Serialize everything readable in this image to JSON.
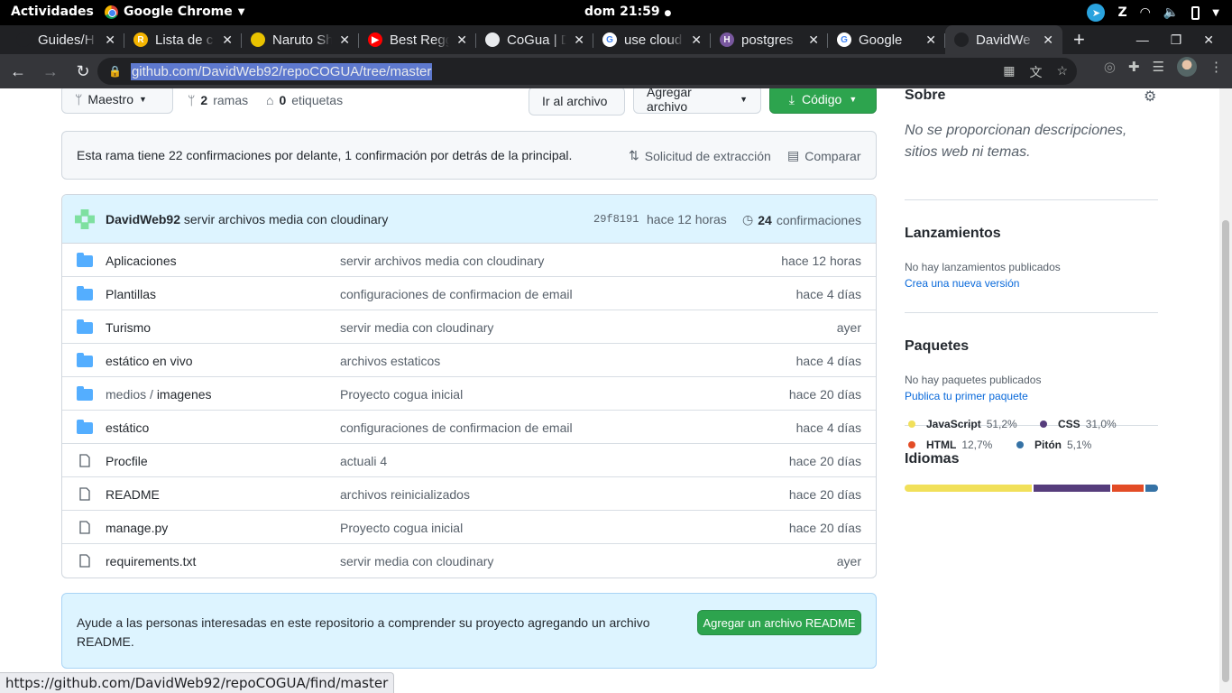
{
  "gnome": {
    "activities": "Actividades",
    "app": "Google Chrome",
    "clock": "dom 21:59"
  },
  "tabs": [
    {
      "title": "Guides/H",
      "fav_color": "#202124",
      "fav_text": ""
    },
    {
      "title": "Lista de c",
      "fav_color": "#f4b400",
      "fav_text": "R"
    },
    {
      "title": "Naruto Sh",
      "fav_color": "#e8c200",
      "fav_text": ""
    },
    {
      "title": "Best Regg",
      "fav_color": "#ff0000",
      "fav_text": "▶"
    },
    {
      "title": "CoGua | D",
      "fav_color": "#e8eaed",
      "fav_text": ""
    },
    {
      "title": "use cloud",
      "fav_color": "#ffffff",
      "fav_text": "G"
    },
    {
      "title": "postgres",
      "fav_color": "#79589f",
      "fav_text": "H"
    },
    {
      "title": "Google",
      "fav_color": "#ffffff",
      "fav_text": "G"
    },
    {
      "title": "DavidWe",
      "fav_color": "#202124",
      "fav_text": ""
    }
  ],
  "omnibox": {
    "url": "github.com/DavidWeb92/repoCOGUA/tree/master"
  },
  "repo": {
    "branch_label": "Maestro",
    "branches_count": "2",
    "branches_label": "ramas",
    "tags_count": "0",
    "tags_label": "etiquetas",
    "goto_file": "Ir al archivo",
    "add_file": "Agregar archivo",
    "code": "Código",
    "ahead_msg": "Esta rama tiene 22 confirmaciones por delante, 1 confirmación por detrás de la principal.",
    "pull_request": "Solicitud de extracción",
    "compare": "Comparar"
  },
  "commit": {
    "author": "DavidWeb92",
    "message": "servir archivos media con cloudinary",
    "sha": "29f8191",
    "time": "hace 12 horas",
    "count": "24",
    "count_label": "confirmaciones"
  },
  "files": [
    {
      "type": "folder",
      "prefix": "",
      "name": "Aplicaciones",
      "msg": "servir archivos media con cloudinary",
      "age": "hace 12 horas"
    },
    {
      "type": "folder",
      "prefix": "",
      "name": "Plantillas",
      "msg": "configuraciones de confirmacion de email",
      "age": "hace 4 días"
    },
    {
      "type": "folder",
      "prefix": "",
      "name": "Turismo",
      "msg": "servir media con cloudinary",
      "age": "ayer"
    },
    {
      "type": "folder",
      "prefix": "",
      "name": "estático en vivo",
      "msg": "archivos estaticos",
      "age": "hace 4 días"
    },
    {
      "type": "folder",
      "prefix": "medios / ",
      "name": "imagenes",
      "msg": "Proyecto cogua inicial",
      "age": "hace 20 días"
    },
    {
      "type": "folder",
      "prefix": "",
      "name": "estático",
      "msg": "configuraciones de confirmacion de email",
      "age": "hace 4 días"
    },
    {
      "type": "file",
      "prefix": "",
      "name": "Procfile",
      "msg": "actuali 4",
      "age": "hace 20 días"
    },
    {
      "type": "file",
      "prefix": "",
      "name": "README",
      "msg": "archivos reinicializados",
      "age": "hace 20 días"
    },
    {
      "type": "file",
      "prefix": "",
      "name": "manage.py",
      "msg": "Proyecto cogua inicial",
      "age": "hace 20 días"
    },
    {
      "type": "file",
      "prefix": "",
      "name": "requirements.txt",
      "msg": "servir media con cloudinary",
      "age": "ayer"
    }
  ],
  "readme_prompt": {
    "text": "Ayude a las personas interesadas en este repositorio a comprender su proyecto agregando un archivo README.",
    "button": "Agregar un archivo README"
  },
  "sidebar": {
    "about_title": "Sobre",
    "about_desc": "No se proporcionan descripciones, sitios web ni temas.",
    "releases_title": "Lanzamientos",
    "releases_none": "No hay lanzamientos publicados",
    "releases_link": "Crea una nueva versión",
    "packages_title": "Paquetes",
    "packages_none": "No hay paquetes publicados",
    "packages_link": "Publica tu primer paquete",
    "languages_title": "Idiomas",
    "languages": [
      {
        "name": "JavaScript",
        "pct": "51,2%",
        "value": 51.2,
        "color": "#f1e05a"
      },
      {
        "name": "CSS",
        "pct": "31,0%",
        "value": 31.0,
        "color": "#563d7c"
      },
      {
        "name": "HTML",
        "pct": "12,7%",
        "value": 12.7,
        "color": "#e34c26"
      },
      {
        "name": "Pitón",
        "pct": "5,1%",
        "value": 5.1,
        "color": "#3572a5"
      }
    ]
  },
  "status_url": "https://github.com/DavidWeb92/repoCOGUA/find/master"
}
